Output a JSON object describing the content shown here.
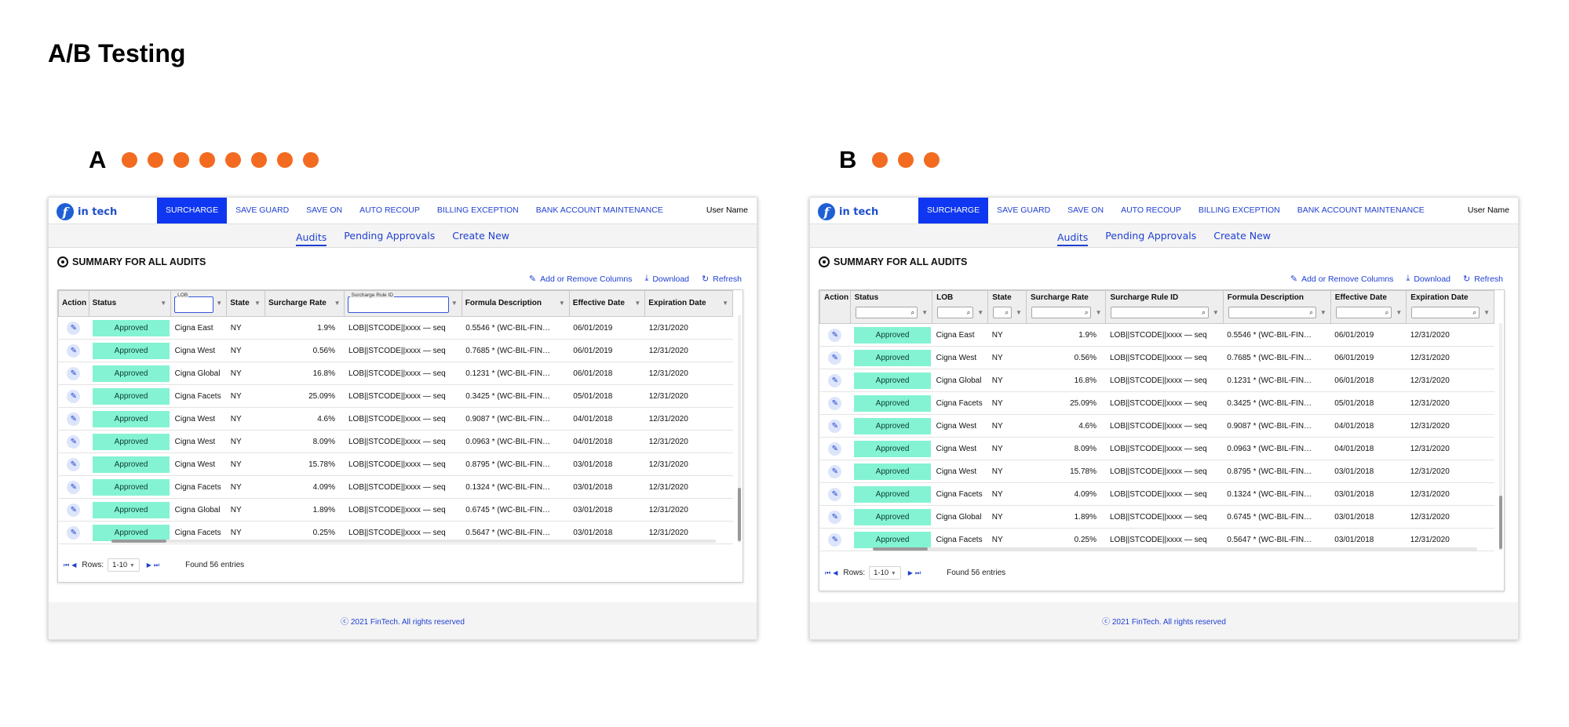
{
  "page_title": "A/B Testing",
  "colors": {
    "accent": "#0f36f0",
    "link": "#1f3fd1",
    "status_pill": "#84f3d3",
    "dot": "#f26b21"
  },
  "app": {
    "logo_text": "in tech",
    "nav": [
      "SURCHARGE",
      "SAVE GUARD",
      "SAVE ON",
      "AUTO RECOUP",
      "BILLING EXCEPTION",
      "BANK ACCOUNT MAINTENANCE"
    ],
    "user_name": "User Name",
    "subtabs": [
      "Audits",
      "Pending Approvals",
      "Create New"
    ],
    "summary_title": "SUMMARY FOR ALL AUDITS",
    "toolbar": {
      "columns": "Add or Remove Columns",
      "download": "Download",
      "refresh": "Refresh"
    },
    "columns": [
      "Action",
      "Status",
      "LOB",
      "State",
      "Surcharge Rate",
      "Surcharge Rule ID",
      "Formula Description",
      "Effective Date",
      "Expiration Date"
    ],
    "rows": [
      {
        "status": "Approved",
        "lob": "Cigna East",
        "state": "NY",
        "rate": "1.9%",
        "rule": "LOB||STCODE||xxxx — seq",
        "formula": "0.5546 * (WC-BIL-FIN…",
        "eff": "06/01/2019",
        "exp": "12/31/2020"
      },
      {
        "status": "Approved",
        "lob": "Cigna West",
        "state": "NY",
        "rate": "0.56%",
        "rule": "LOB||STCODE||xxxx — seq",
        "formula": "0.7685 * (WC-BIL-FIN…",
        "eff": "06/01/2019",
        "exp": "12/31/2020"
      },
      {
        "status": "Approved",
        "lob": "Cigna Global",
        "state": "NY",
        "rate": "16.8%",
        "rule": "LOB||STCODE||xxxx — seq",
        "formula": "0.1231 * (WC-BIL-FIN…",
        "eff": "06/01/2018",
        "exp": "12/31/2020"
      },
      {
        "status": "Approved",
        "lob": "Cigna Facets",
        "state": "NY",
        "rate": "25.09%",
        "rule": "LOB||STCODE||xxxx — seq",
        "formula": "0.3425 * (WC-BIL-FIN…",
        "eff": "05/01/2018",
        "exp": "12/31/2020"
      },
      {
        "status": "Approved",
        "lob": "Cigna West",
        "state": "NY",
        "rate": "4.6%",
        "rule": "LOB||STCODE||xxxx — seq",
        "formula": "0.9087 * (WC-BIL-FIN…",
        "eff": "04/01/2018",
        "exp": "12/31/2020"
      },
      {
        "status": "Approved",
        "lob": "Cigna West",
        "state": "NY",
        "rate": "8.09%",
        "rule": "LOB||STCODE||xxxx — seq",
        "formula": "0.0963 * (WC-BIL-FIN…",
        "eff": "04/01/2018",
        "exp": "12/31/2020"
      },
      {
        "status": "Approved",
        "lob": "Cigna West",
        "state": "NY",
        "rate": "15.78%",
        "rule": "LOB||STCODE||xxxx — seq",
        "formula": "0.8795 * (WC-BIL-FIN…",
        "eff": "03/01/2018",
        "exp": "12/31/2020"
      },
      {
        "status": "Approved",
        "lob": "Cigna Facets",
        "state": "NY",
        "rate": "4.09%",
        "rule": "LOB||STCODE||xxxx — seq",
        "formula": "0.1324 * (WC-BIL-FIN…",
        "eff": "03/01/2018",
        "exp": "12/31/2020"
      },
      {
        "status": "Approved",
        "lob": "Cigna Global",
        "state": "NY",
        "rate": "1.89%",
        "rule": "LOB||STCODE||xxxx — seq",
        "formula": "0.6745 * (WC-BIL-FIN…",
        "eff": "03/01/2018",
        "exp": "12/31/2020"
      },
      {
        "status": "Approved",
        "lob": "Cigna Facets",
        "state": "NY",
        "rate": "0.25%",
        "rule": "LOB||STCODE||xxxx — seq",
        "formula": "0.5647 * (WC-BIL-FIN…",
        "eff": "03/01/2018",
        "exp": "12/31/2020"
      }
    ],
    "pager": {
      "rows_label": "Rows:",
      "rows_value": "1-10",
      "found": "Found 56 entries"
    },
    "footer": "ⓒ 2021 FinTech. All rights reserved"
  },
  "variants": [
    {
      "letter": "A",
      "dots": 8,
      "lob_filter_label": "LOB",
      "rule_filter_label": "Surcharge Rule ID"
    },
    {
      "letter": "B",
      "dots": 3
    }
  ]
}
